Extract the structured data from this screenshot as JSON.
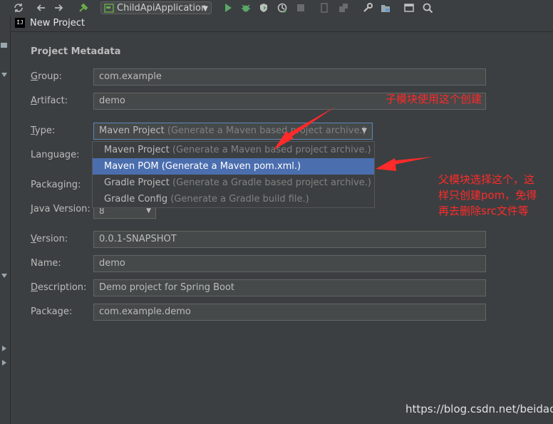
{
  "toolbar": {
    "run_config": "ChildApiApplication",
    "icons": [
      "sync-icon",
      "back-icon",
      "forward-icon",
      "build-icon",
      "run-icon",
      "debug-icon",
      "coverage-icon",
      "profile-icon",
      "stop-icon",
      "attach-icon",
      "sdk-icon",
      "settings-icon",
      "structure-icon",
      "terminal-icon",
      "search-icon"
    ]
  },
  "dialog": {
    "title": "New Project",
    "section_title": "Project Metadata",
    "fields": {
      "group": {
        "label": "Group:",
        "mnemonic": "G",
        "rest": "roup:",
        "value": "com.example"
      },
      "artifact": {
        "label": "Artifact:",
        "mnemonic": "A",
        "rest": "rtifact:",
        "value": "demo"
      },
      "type": {
        "label": "Type:",
        "mnemonic": "T",
        "rest": "ype:",
        "value_main": "Maven Project",
        "value_hint": "(Generate a Maven based project archive.)"
      },
      "language": {
        "label": "Language:"
      },
      "packaging": {
        "label": "Packaging:"
      },
      "java_version": {
        "label": "Java Version:",
        "mnemonic": "J",
        "rest": "ava Version:",
        "value": "8"
      },
      "version": {
        "label": "Version:",
        "mnemonic": "V",
        "rest": "ersion:",
        "value": "0.0.1-SNAPSHOT"
      },
      "name": {
        "label": "Name:",
        "mnemonic": "N",
        "rest": "ame:",
        "value": "demo"
      },
      "description": {
        "label": "Description:",
        "mnemonic": "D",
        "rest": "escription:",
        "value": "Demo project for Spring Boot"
      },
      "package": {
        "label": "Package:",
        "mnemonic": "P",
        "rest": "ackage:",
        "value": "com.example.demo"
      }
    },
    "type_options": [
      {
        "main": "Maven Project",
        "hint": "(Generate a Maven based project archive.)",
        "selected": false
      },
      {
        "main": "Maven POM",
        "hint": "(Generate a Maven pom.xml.)",
        "selected": true
      },
      {
        "main": "Gradle Project",
        "hint": "(Generate a Gradle based project archive.)",
        "selected": false
      },
      {
        "main": "Gradle Config",
        "hint": "(Generate a Gradle build file.)",
        "selected": false
      }
    ]
  },
  "annotations": {
    "child_module": "子模块使用这个创建",
    "parent_line1": "父模块选择这个，这",
    "parent_line2": "样只创建pom，免得",
    "parent_line3": "再去删除src文件等",
    "color": "#ff2a2a"
  },
  "watermark": "https://blog.csdn.net/beidaol"
}
